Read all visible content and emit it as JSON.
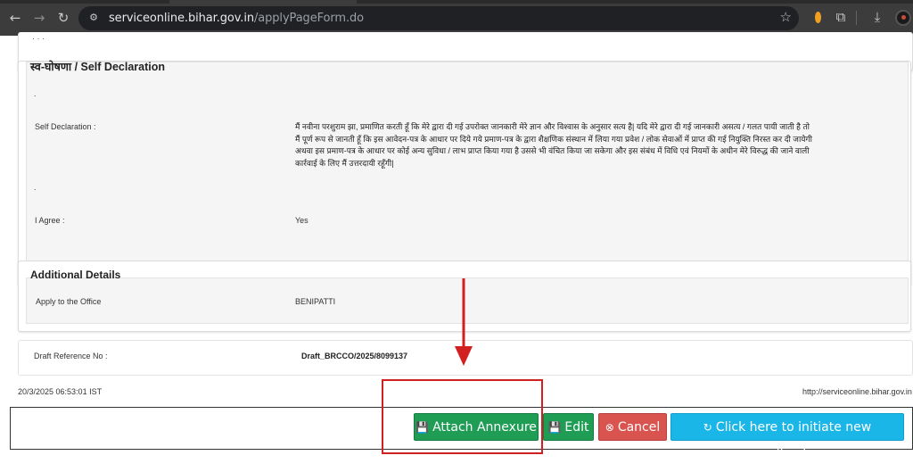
{
  "browser": {
    "url_host": "serviceonline.bihar.gov.in",
    "url_path": "/applyPageForm.do"
  },
  "self_declaration": {
    "title": "स्व-घोषणा / Self Declaration",
    "dot1": ".",
    "label": "Self Declaration :",
    "text": "मैं नवीना परशुराम झा, प्रमाणित करती हूँ कि मेरे द्वारा दी गई उपरोक्त जानकारी मेरे ज्ञान और विश्वास के अनुसार सत्य है| यदि मेरे द्वारा दी गई जानकारी असत्य / गलत पायी जाती है तो मैं पूर्ण रूप से जानती हूँ कि इस आवेदन-पत्र के आधार पर दिये गये प्रमाण-पत्र के द्वारा शैक्षणिक संस्थान में लिया गया प्रवेश / लोक सेवाओं में प्राप्त की गई नियुक्ति निरस्त कर दी जायेगी अथवा इस प्रमाण-पत्र के आधार पर कोई अन्य सुविधा / लाभ प्राप्त किया गया है उससे भी वंचित किया जा सकेगा और इस संबंध में विधि एवं नियमों के अधीन मेरे विरुद्ध की जाने वाली कार्रवाई के लिए मैं उत्तरदायी रहूँगी|",
    "dot2": ".",
    "agree_label": "I Agree :",
    "agree_value": "Yes"
  },
  "additional_details": {
    "title": "Additional Details",
    "office_label": "Apply to the Office",
    "office_value": "BENIPATTI"
  },
  "draft": {
    "label": "Draft Reference No :",
    "value": "Draft_BRCCO/2025/8099137"
  },
  "footer": {
    "timestamp": "20/3/2025 06:53:01 IST",
    "site": "http://serviceonline.bihar.gov.in"
  },
  "buttons": {
    "attach": "Attach Annexure",
    "edit": "Edit",
    "cancel": "Cancel",
    "new_application": "Click here to initiate new application"
  },
  "colors": {
    "success": "#1f9d55",
    "danger": "#d9534f",
    "info": "#1ab6e8",
    "annotation": "#d21f1f"
  }
}
